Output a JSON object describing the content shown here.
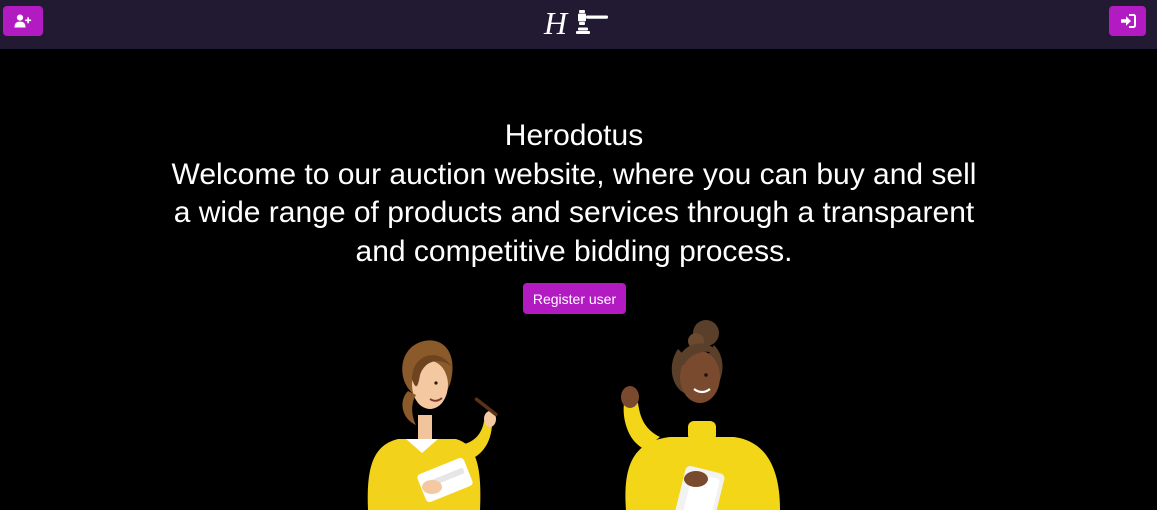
{
  "app": {
    "logo_icon": "gavel-logo-icon",
    "logo_letter": "H"
  },
  "navbar": {
    "left_button_icon": "user-plus-icon",
    "right_button_icon": "sign-in-icon",
    "accent_color": "#b21bc1",
    "background_color": "#221a33"
  },
  "hero": {
    "title": "Herodotus",
    "description": "Welcome to our auction website, where you can buy and sell a wide range of products and services through a transparent and competitive bidding process.",
    "cta_label": "Register user",
    "background_color": "#000000"
  },
  "illustrations": {
    "left": "woman-with-pen-and-notepad",
    "right": "woman-holding-notepad-raising-fist"
  }
}
